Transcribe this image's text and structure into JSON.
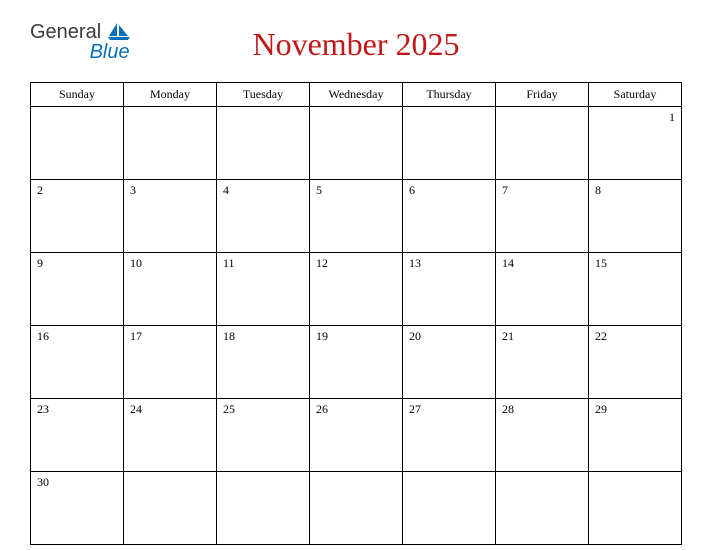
{
  "brand": {
    "word1": "General",
    "word2": "Blue"
  },
  "title": "November 2025",
  "dayHeaders": [
    "Sunday",
    "Monday",
    "Tuesday",
    "Wednesday",
    "Thursday",
    "Friday",
    "Saturday"
  ],
  "weeks": [
    [
      {
        "day": "",
        "align": "left"
      },
      {
        "day": "",
        "align": "left"
      },
      {
        "day": "",
        "align": "left"
      },
      {
        "day": "",
        "align": "left"
      },
      {
        "day": "",
        "align": "left"
      },
      {
        "day": "",
        "align": "left"
      },
      {
        "day": "1",
        "align": "right"
      }
    ],
    [
      {
        "day": "2",
        "align": "left"
      },
      {
        "day": "3",
        "align": "left"
      },
      {
        "day": "4",
        "align": "left"
      },
      {
        "day": "5",
        "align": "left"
      },
      {
        "day": "6",
        "align": "left"
      },
      {
        "day": "7",
        "align": "left"
      },
      {
        "day": "8",
        "align": "left"
      }
    ],
    [
      {
        "day": "9",
        "align": "left"
      },
      {
        "day": "10",
        "align": "left"
      },
      {
        "day": "11",
        "align": "left"
      },
      {
        "day": "12",
        "align": "left"
      },
      {
        "day": "13",
        "align": "left"
      },
      {
        "day": "14",
        "align": "left"
      },
      {
        "day": "15",
        "align": "left"
      }
    ],
    [
      {
        "day": "16",
        "align": "left"
      },
      {
        "day": "17",
        "align": "left"
      },
      {
        "day": "18",
        "align": "left"
      },
      {
        "day": "19",
        "align": "left"
      },
      {
        "day": "20",
        "align": "left"
      },
      {
        "day": "21",
        "align": "left"
      },
      {
        "day": "22",
        "align": "left"
      }
    ],
    [
      {
        "day": "23",
        "align": "left"
      },
      {
        "day": "24",
        "align": "left"
      },
      {
        "day": "25",
        "align": "left"
      },
      {
        "day": "26",
        "align": "left"
      },
      {
        "day": "27",
        "align": "left"
      },
      {
        "day": "28",
        "align": "left"
      },
      {
        "day": "29",
        "align": "left"
      }
    ],
    [
      {
        "day": "30",
        "align": "left"
      },
      {
        "day": "",
        "align": "left"
      },
      {
        "day": "",
        "align": "left"
      },
      {
        "day": "",
        "align": "left"
      },
      {
        "day": "",
        "align": "left"
      },
      {
        "day": "",
        "align": "left"
      },
      {
        "day": "",
        "align": "left"
      }
    ]
  ]
}
